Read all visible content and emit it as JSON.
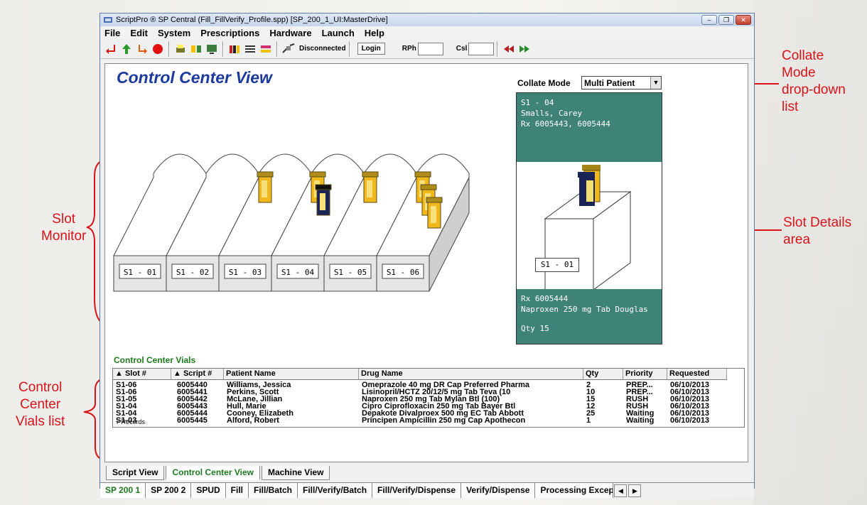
{
  "window": {
    "title": "ScriptPro ® SP Central (Fill_FillVerify_Profile.spp) [SP_200_1_UI:MasterDrive]"
  },
  "menu": [
    "File",
    "Edit",
    "System",
    "Prescriptions",
    "Hardware",
    "Launch",
    "Help"
  ],
  "toolbar": {
    "status": "Disconnected",
    "login_label": "Login",
    "rph_label": "RPh",
    "csl_label": "Csl"
  },
  "main": {
    "title": "Control Center View",
    "collate_label": "Collate Mode",
    "collate_value": "Multi Patient"
  },
  "slots": [
    {
      "label": "S1 - 01",
      "vials": 0
    },
    {
      "label": "S1 - 02",
      "vials": 0
    },
    {
      "label": "S1 - 03",
      "vials": 1
    },
    {
      "label": "S1 - 04",
      "vials": 2
    },
    {
      "label": "S1 - 05",
      "vials": 1
    },
    {
      "label": "S1 - 06",
      "vials": 3
    }
  ],
  "details": {
    "slot": "S1 - 04",
    "patient": "Smalls, Carey",
    "rx_header": "Rx 6005443, 6005444",
    "slot_label": "S1 - 01",
    "rx": "Rx 6005444",
    "drug": "Naproxen 250 mg Tab Douglas",
    "qty": "Qty 15"
  },
  "vials": {
    "title": "Control Center Vials",
    "headers": [
      "Slot #",
      "Script #",
      "Patient Name",
      "Drug Name",
      "Qty",
      "Priority",
      "Requested"
    ],
    "rows": [
      {
        "slot": "S1-06",
        "script": "6005440",
        "patient": "Williams, Jessica",
        "drug": "Omeprazole 40 mg DR Cap Preferred Pharma",
        "qty": "2",
        "priority": "PREP...",
        "requested": "06/10/2013"
      },
      {
        "slot": "S1-06",
        "script": "6005441",
        "patient": "Perkins, Scott",
        "drug": "Lisinopril/HCTZ 20/12/5 mg Tab Teva (10",
        "qty": "10",
        "priority": "PREP...",
        "requested": "06/10/2013"
      },
      {
        "slot": "S1-05",
        "script": "6005442",
        "patient": "McLane, Jillian",
        "drug": "Naproxen 250 mg Tab Mylan Btl (100)",
        "qty": "15",
        "priority": "RUSH",
        "requested": "06/10/2013"
      },
      {
        "slot": "S1-04",
        "script": "6005443",
        "patient": "Hull, Marie",
        "drug": "Cipro Ciprofloxacin 250 mg Tab Bayer Btl",
        "qty": "12",
        "priority": "RUSH",
        "requested": "06/10/2013"
      },
      {
        "slot": "S1-04",
        "script": "6005444",
        "patient": "Cooney, Elizabeth",
        "drug": "Depakote Divalproex 500 mg EC Tab Abbott",
        "qty": "25",
        "priority": "Waiting",
        "requested": "06/10/2013"
      },
      {
        "slot": "S1-03",
        "script": "6005445",
        "patient": "Alford, Robert",
        "drug": "Principen Ampicillin 250 mg Cap Apothecon",
        "qty": "1",
        "priority": "Waiting",
        "requested": "06/10/2013"
      }
    ],
    "records": "7 Records"
  },
  "view_tabs": [
    "Script View",
    "Control Center View",
    "Machine View"
  ],
  "bottom_tabs": [
    "SP 200 1",
    "SP 200 2",
    "SPUD",
    "Fill",
    "Fill/Batch",
    "Fill/Verify/Batch",
    "Fill/Verify/Dispense",
    "Verify/Dispense",
    "Processing Excepti"
  ],
  "annotations": {
    "collate": [
      "Collate",
      "Mode",
      "drop-down",
      "list"
    ],
    "slot_monitor": [
      "Slot",
      "Monitor"
    ],
    "slot_details": [
      "Slot Details",
      "area"
    ],
    "vials_list": [
      "Control",
      "Center",
      "Vials list"
    ]
  },
  "colors": {
    "annotation": "#d7141a",
    "title_blue": "#1c3a9e",
    "detail_teal": "#3f8277",
    "active_green": "#1c7a1c",
    "vial_amber": "#f0b81c",
    "vial_dark": "#1a2456"
  }
}
